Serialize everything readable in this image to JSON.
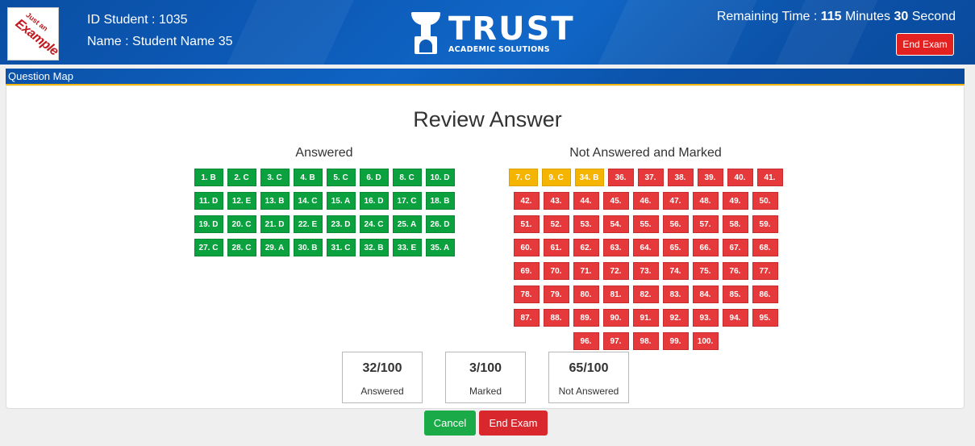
{
  "header": {
    "logo_small": "Just an",
    "logo_big": "Example",
    "student_id": "ID Student : 1035",
    "student_name": "Name : Student Name 35",
    "brand_name": "TRUST",
    "brand_tagline": "ACADEMIC SOLUTIONS",
    "timer_prefix": "Remaining Time : ",
    "timer_minutes": "115",
    "timer_minutes_label": " Minutes ",
    "timer_seconds": "30",
    "timer_seconds_label": " Second",
    "end_exam_label": "End Exam"
  },
  "map_bar": {
    "label": "Question Map"
  },
  "review": {
    "title": "Review Answer",
    "answered_heading": "Answered",
    "not_answered_heading": "Not Answered and Marked",
    "answered": [
      "1. B",
      "2. C",
      "3. C",
      "4. B",
      "5. C",
      "6. D",
      "8. C",
      "10. D",
      "11. D",
      "12. E",
      "13. B",
      "14. C",
      "15. A",
      "16. D",
      "17. C",
      "18. B",
      "19. D",
      "20. C",
      "21. D",
      "22. E",
      "23. D",
      "24. C",
      "25. A",
      "26. D",
      "27. C",
      "28. C",
      "29. A",
      "30. B",
      "31. C",
      "32. B",
      "33. E",
      "35. A"
    ],
    "marked": [
      "7. C",
      "9. C",
      "34. B"
    ],
    "not_answered": [
      "36.",
      "37.",
      "38.",
      "39.",
      "40.",
      "41.",
      "42.",
      "43.",
      "44.",
      "45.",
      "46.",
      "47.",
      "48.",
      "49.",
      "50.",
      "51.",
      "52.",
      "53.",
      "54.",
      "55.",
      "56.",
      "57.",
      "58.",
      "59.",
      "60.",
      "61.",
      "62.",
      "63.",
      "64.",
      "65.",
      "66.",
      "67.",
      "68.",
      "69.",
      "70.",
      "71.",
      "72.",
      "73.",
      "74.",
      "75.",
      "76.",
      "77.",
      "78.",
      "79.",
      "80.",
      "81.",
      "82.",
      "83.",
      "84.",
      "85.",
      "86.",
      "87.",
      "88.",
      "89.",
      "90.",
      "91.",
      "92.",
      "93.",
      "94.",
      "95.",
      "96.",
      "97.",
      "98.",
      "99.",
      "100."
    ]
  },
  "stats": [
    {
      "value": "32/100",
      "label": "Answered"
    },
    {
      "value": "3/100",
      "label": "Marked"
    },
    {
      "value": "65/100",
      "label": "Not Answered"
    }
  ],
  "footer": {
    "cancel_label": "Cancel",
    "end_exam_label": "End Exam"
  },
  "colors": {
    "answered": "#0aa13e",
    "marked": "#f4b400",
    "not_answered": "#e5393b",
    "header_blue": "#0d5cba",
    "accent_gold": "#f2b705"
  }
}
